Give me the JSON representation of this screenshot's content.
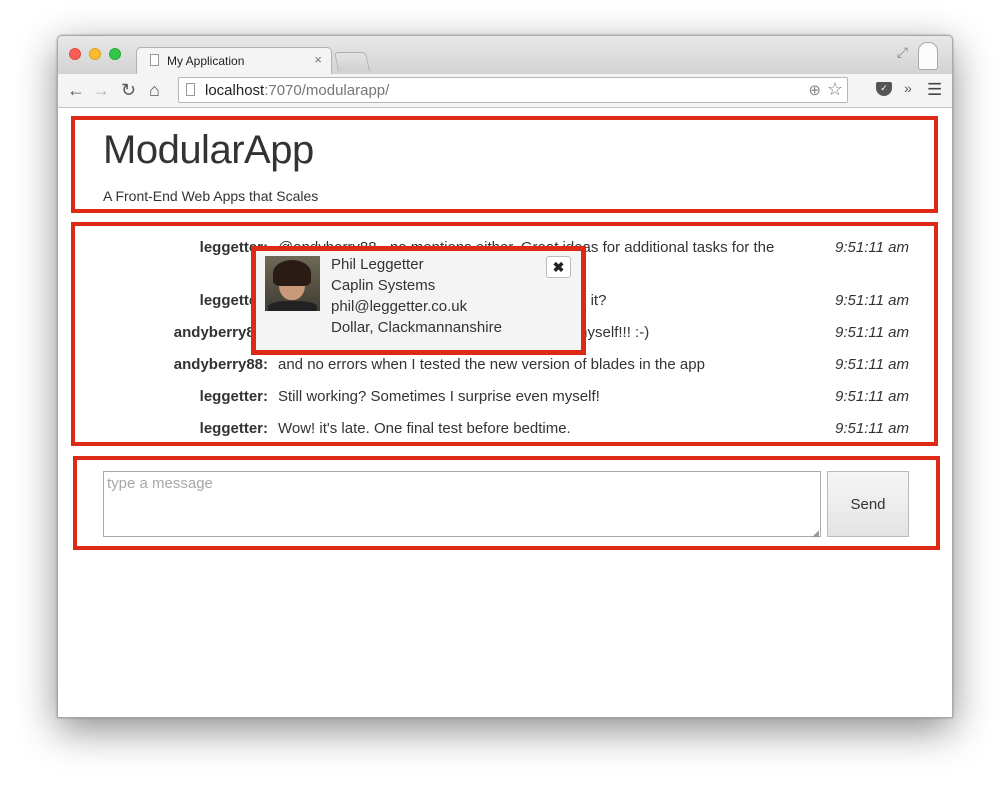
{
  "browser": {
    "tab_title": "My Application",
    "tab_close": "×",
    "url_host": "localhost",
    "url_rest": ":7070/modularapp/",
    "icons": {
      "back": "back-arrow-icon",
      "forward": "forward-arrow-icon",
      "reload": "reload-icon",
      "home": "home-icon",
      "zoom": "zoom-icon",
      "star": "bookmark-star-icon",
      "pocket": "pocket-icon",
      "overflow": "chevron-double-right-icon",
      "menu": "hamburger-menu-icon"
    }
  },
  "header": {
    "title": "ModularApp",
    "subtitle": "A Front-End Web Apps that Scales"
  },
  "messages": [
    {
      "user": "leggetter:",
      "text": "@andyberry88 - no mentions either. Great ideas for additional tasks for the",
      "time": "9:51:11 am"
    },
    {
      "user": "leggetter:",
      "text": "This is still working. Well, is it?",
      "time": "9:51:11 am"
    },
    {
      "user": "andyberry88:",
      "text": "I built myself!!! :-)",
      "time": "9:51:11 am"
    },
    {
      "user": "andyberry88:",
      "text": "and no errors when I tested the new version of blades in the app",
      "time": "9:51:11 am"
    },
    {
      "user": "leggetter:",
      "text": "Still working? Sometimes I surprise even myself!",
      "time": "9:51:11 am"
    },
    {
      "user": "leggetter:",
      "text": "Wow! it's late. One final test before bedtime.",
      "time": "9:51:11 am"
    }
  ],
  "composer": {
    "placeholder": "type a message",
    "value": "",
    "send_label": "Send"
  },
  "profile_card": {
    "name": "Phil Leggetter",
    "company": "Caplin Systems",
    "email": "phil@leggetter.co.uk",
    "location": "Dollar, Clackmannanshire",
    "close_label": "✖"
  },
  "colors": {
    "accent_border": "#dc2a15",
    "text": "#333333"
  }
}
